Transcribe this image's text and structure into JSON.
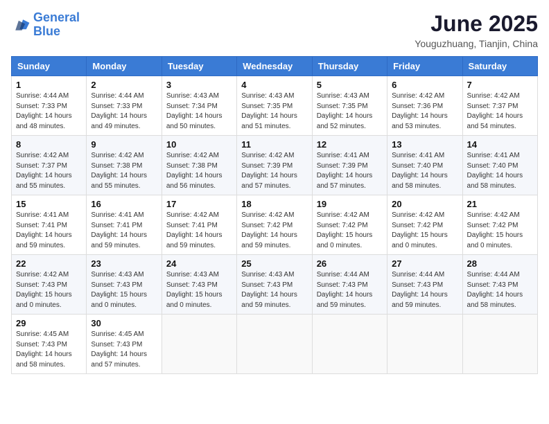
{
  "header": {
    "logo_line1": "General",
    "logo_line2": "Blue",
    "title": "June 2025",
    "location": "Youguzhuang, Tianjin, China"
  },
  "weekdays": [
    "Sunday",
    "Monday",
    "Tuesday",
    "Wednesday",
    "Thursday",
    "Friday",
    "Saturday"
  ],
  "weeks": [
    [
      {
        "day": "1",
        "info": "Sunrise: 4:44 AM\nSunset: 7:33 PM\nDaylight: 14 hours\nand 48 minutes."
      },
      {
        "day": "2",
        "info": "Sunrise: 4:44 AM\nSunset: 7:33 PM\nDaylight: 14 hours\nand 49 minutes."
      },
      {
        "day": "3",
        "info": "Sunrise: 4:43 AM\nSunset: 7:34 PM\nDaylight: 14 hours\nand 50 minutes."
      },
      {
        "day": "4",
        "info": "Sunrise: 4:43 AM\nSunset: 7:35 PM\nDaylight: 14 hours\nand 51 minutes."
      },
      {
        "day": "5",
        "info": "Sunrise: 4:43 AM\nSunset: 7:35 PM\nDaylight: 14 hours\nand 52 minutes."
      },
      {
        "day": "6",
        "info": "Sunrise: 4:42 AM\nSunset: 7:36 PM\nDaylight: 14 hours\nand 53 minutes."
      },
      {
        "day": "7",
        "info": "Sunrise: 4:42 AM\nSunset: 7:37 PM\nDaylight: 14 hours\nand 54 minutes."
      }
    ],
    [
      {
        "day": "8",
        "info": "Sunrise: 4:42 AM\nSunset: 7:37 PM\nDaylight: 14 hours\nand 55 minutes."
      },
      {
        "day": "9",
        "info": "Sunrise: 4:42 AM\nSunset: 7:38 PM\nDaylight: 14 hours\nand 55 minutes."
      },
      {
        "day": "10",
        "info": "Sunrise: 4:42 AM\nSunset: 7:38 PM\nDaylight: 14 hours\nand 56 minutes."
      },
      {
        "day": "11",
        "info": "Sunrise: 4:42 AM\nSunset: 7:39 PM\nDaylight: 14 hours\nand 57 minutes."
      },
      {
        "day": "12",
        "info": "Sunrise: 4:41 AM\nSunset: 7:39 PM\nDaylight: 14 hours\nand 57 minutes."
      },
      {
        "day": "13",
        "info": "Sunrise: 4:41 AM\nSunset: 7:40 PM\nDaylight: 14 hours\nand 58 minutes."
      },
      {
        "day": "14",
        "info": "Sunrise: 4:41 AM\nSunset: 7:40 PM\nDaylight: 14 hours\nand 58 minutes."
      }
    ],
    [
      {
        "day": "15",
        "info": "Sunrise: 4:41 AM\nSunset: 7:41 PM\nDaylight: 14 hours\nand 59 minutes."
      },
      {
        "day": "16",
        "info": "Sunrise: 4:41 AM\nSunset: 7:41 PM\nDaylight: 14 hours\nand 59 minutes."
      },
      {
        "day": "17",
        "info": "Sunrise: 4:42 AM\nSunset: 7:41 PM\nDaylight: 14 hours\nand 59 minutes."
      },
      {
        "day": "18",
        "info": "Sunrise: 4:42 AM\nSunset: 7:42 PM\nDaylight: 14 hours\nand 59 minutes."
      },
      {
        "day": "19",
        "info": "Sunrise: 4:42 AM\nSunset: 7:42 PM\nDaylight: 15 hours\nand 0 minutes."
      },
      {
        "day": "20",
        "info": "Sunrise: 4:42 AM\nSunset: 7:42 PM\nDaylight: 15 hours\nand 0 minutes."
      },
      {
        "day": "21",
        "info": "Sunrise: 4:42 AM\nSunset: 7:42 PM\nDaylight: 15 hours\nand 0 minutes."
      }
    ],
    [
      {
        "day": "22",
        "info": "Sunrise: 4:42 AM\nSunset: 7:43 PM\nDaylight: 15 hours\nand 0 minutes."
      },
      {
        "day": "23",
        "info": "Sunrise: 4:43 AM\nSunset: 7:43 PM\nDaylight: 15 hours\nand 0 minutes."
      },
      {
        "day": "24",
        "info": "Sunrise: 4:43 AM\nSunset: 7:43 PM\nDaylight: 15 hours\nand 0 minutes."
      },
      {
        "day": "25",
        "info": "Sunrise: 4:43 AM\nSunset: 7:43 PM\nDaylight: 14 hours\nand 59 minutes."
      },
      {
        "day": "26",
        "info": "Sunrise: 4:44 AM\nSunset: 7:43 PM\nDaylight: 14 hours\nand 59 minutes."
      },
      {
        "day": "27",
        "info": "Sunrise: 4:44 AM\nSunset: 7:43 PM\nDaylight: 14 hours\nand 59 minutes."
      },
      {
        "day": "28",
        "info": "Sunrise: 4:44 AM\nSunset: 7:43 PM\nDaylight: 14 hours\nand 58 minutes."
      }
    ],
    [
      {
        "day": "29",
        "info": "Sunrise: 4:45 AM\nSunset: 7:43 PM\nDaylight: 14 hours\nand 58 minutes."
      },
      {
        "day": "30",
        "info": "Sunrise: 4:45 AM\nSunset: 7:43 PM\nDaylight: 14 hours\nand 57 minutes."
      },
      {
        "day": "",
        "info": ""
      },
      {
        "day": "",
        "info": ""
      },
      {
        "day": "",
        "info": ""
      },
      {
        "day": "",
        "info": ""
      },
      {
        "day": "",
        "info": ""
      }
    ]
  ]
}
